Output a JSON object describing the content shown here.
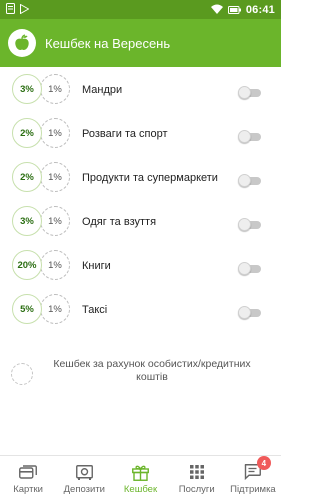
{
  "status_bar": {
    "time": "06:41",
    "icons": [
      "notification-icon",
      "play-store-icon",
      "wifi-icon",
      "battery-icon"
    ]
  },
  "app_bar": {
    "title": "Кешбек на Вересень",
    "logo_icon": "apple-icon"
  },
  "categories": [
    {
      "cashback": "3%",
      "base": "1%",
      "label": "Мандри",
      "enabled": false
    },
    {
      "cashback": "2%",
      "base": "1%",
      "label": "Розваги та спорт",
      "enabled": false
    },
    {
      "cashback": "2%",
      "base": "1%",
      "label": "Продукти та супермаркети",
      "enabled": false
    },
    {
      "cashback": "3%",
      "base": "1%",
      "label": "Одяг та взуття",
      "enabled": false
    },
    {
      "cashback": "20%",
      "base": "1%",
      "label": "Книги",
      "enabled": false
    },
    {
      "cashback": "5%",
      "base": "1%",
      "label": "Таксі",
      "enabled": false
    }
  ],
  "own_funds": {
    "label": "Кешбек за рахунок особистих/кредитних коштів",
    "selected": false
  },
  "bottom_nav": {
    "items": [
      {
        "label": "Картки",
        "icon": "cards-icon",
        "active": false
      },
      {
        "label": "Депозити",
        "icon": "safe-icon",
        "active": false
      },
      {
        "label": "Кешбек",
        "icon": "gift-icon",
        "active": true
      },
      {
        "label": "Послуги",
        "icon": "grid-icon",
        "active": false
      },
      {
        "label": "Підтримка",
        "icon": "chat-icon",
        "active": false,
        "badge": "4"
      }
    ]
  },
  "colors": {
    "brand": "#6bb52b",
    "status_bar": "#5a9a1f",
    "cashback_text": "#2b6e12",
    "badge": "#f05a5a"
  }
}
